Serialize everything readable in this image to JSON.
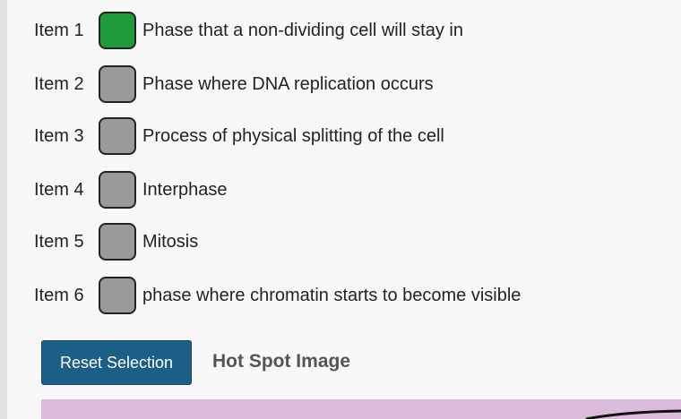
{
  "items": [
    {
      "label": "Item 1",
      "description": "Phase that a non-dividing cell will stay in",
      "color": "#1e9a39",
      "state": "selected"
    },
    {
      "label": "Item 2",
      "description": "Phase where DNA replication occurs",
      "color": "#9a9a9a",
      "state": "unselected"
    },
    {
      "label": "Item 3",
      "description": "Process of physical splitting of the cell",
      "color": "#9a9a9a",
      "state": "unselected"
    },
    {
      "label": "Item 4",
      "description": "Interphase",
      "color": "#9a9a9a",
      "state": "unselected"
    },
    {
      "label": "Item 5",
      "description": "Mitosis",
      "color": "#9a9a9a",
      "state": "unselected"
    },
    {
      "label": "Item 6",
      "description": "phase where chromatin starts to become visible",
      "color": "#9a9a9a",
      "state": "unselected"
    }
  ],
  "controls": {
    "reset_label": "Reset Selection",
    "reset_color": "#1b5e86"
  },
  "hotspot": {
    "title": "Hot Spot Image",
    "background_color": "#dcbcdc"
  }
}
